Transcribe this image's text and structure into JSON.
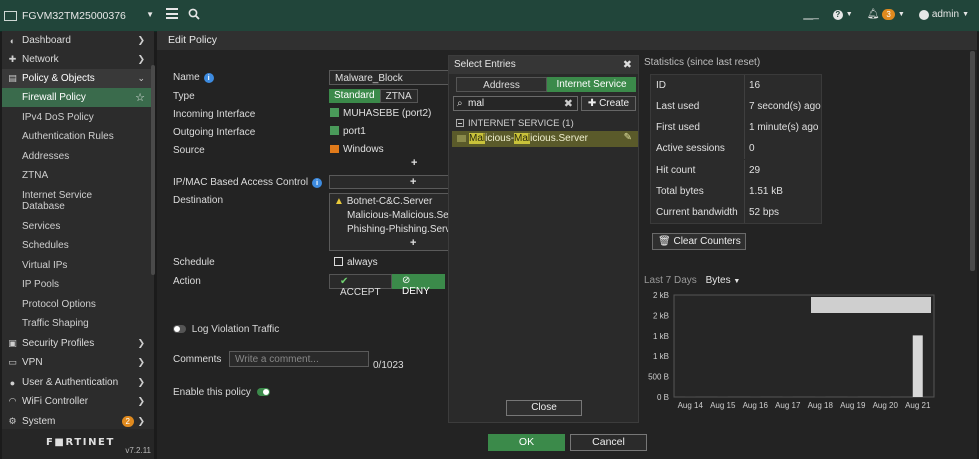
{
  "topbar": {
    "device_name": "FGVM32TM25000376",
    "terminal_label": "⎽_",
    "help_label": "?",
    "alerts_count": "3",
    "user": "admin"
  },
  "sidebar": {
    "items": [
      {
        "label": "Dashboard",
        "icon": "dashboard-icon",
        "glyph": "◐"
      },
      {
        "label": "Network",
        "icon": "network-icon",
        "glyph": "✚"
      },
      {
        "label": "Policy & Objects",
        "icon": "policy-icon",
        "glyph": "▤"
      },
      {
        "label": "Firewall Policy"
      },
      {
        "label": "IPv4 DoS Policy"
      },
      {
        "label": "Authentication Rules"
      },
      {
        "label": "Addresses"
      },
      {
        "label": "ZTNA"
      },
      {
        "label": "Internet Service Database"
      },
      {
        "label": "Services"
      },
      {
        "label": "Schedules"
      },
      {
        "label": "Virtual IPs"
      },
      {
        "label": "IP Pools"
      },
      {
        "label": "Protocol Options"
      },
      {
        "label": "Traffic Shaping"
      },
      {
        "label": "Security Profiles",
        "icon": "lock-icon",
        "glyph": "▣"
      },
      {
        "label": "VPN",
        "icon": "vpn-icon",
        "glyph": "▭"
      },
      {
        "label": "User & Authentication",
        "icon": "user-icon",
        "glyph": "●"
      },
      {
        "label": "WiFi Controller",
        "icon": "wifi-icon",
        "glyph": "◠"
      },
      {
        "label": "System",
        "icon": "gear-icon",
        "glyph": "⚙",
        "badge": "2"
      }
    ],
    "logo": "F■RTINET",
    "version": "v7.2.11"
  },
  "edit": {
    "title": "Edit Policy",
    "labels": {
      "name": "Name",
      "type": "Type",
      "incoming": "Incoming Interface",
      "outgoing": "Outgoing Interface",
      "source": "Source",
      "ipmac": "IP/MAC Based Access Control",
      "destination": "Destination",
      "schedule": "Schedule",
      "action": "Action",
      "log_violation": "Log Violation Traffic",
      "comments": "Comments",
      "enable": "Enable this policy"
    },
    "name_value": "Malware_Block",
    "type_options": [
      "Standard",
      "ZTNA"
    ],
    "incoming_value": "MUHASEBE (port2)",
    "outgoing_value": "port1",
    "source_value": "Windows",
    "destinations": [
      "Botnet-C&C.Server",
      "Malicious-Malicious.Server",
      "Phishing-Phishing.Server"
    ],
    "schedule_value": "always",
    "accept_label": "ACCEPT",
    "deny_label": "DENY",
    "comments_placeholder": "Write a comment...",
    "comments_count": "0/1023",
    "plus": "+"
  },
  "select_entries": {
    "title": "Select Entries",
    "close_glyph": "✖",
    "tabs": [
      "Address",
      "Internet Service"
    ],
    "search_value": "mal",
    "create_label": "Create",
    "group_label": "INTERNET SERVICE (1)",
    "entry_parts": [
      "",
      "Mal",
      "icious-",
      "Mal",
      "icious.Server"
    ],
    "close_label": "Close"
  },
  "stats": {
    "title": "Statistics (since last reset)",
    "rows": [
      {
        "key": "ID",
        "value": "16"
      },
      {
        "key": "Last used",
        "value": "7 second(s) ago"
      },
      {
        "key": "First used",
        "value": "1 minute(s) ago"
      },
      {
        "key": "Active sessions",
        "value": "0"
      },
      {
        "key": "Hit count",
        "value": "29"
      },
      {
        "key": "Total bytes",
        "value": "1.51 kB"
      },
      {
        "key": "Current bandwidth",
        "value": "52 bps"
      }
    ],
    "clear_label": "Clear Counters",
    "range_label": "Last 7 Days",
    "unit_select": "Bytes"
  },
  "chart_data": {
    "type": "bar",
    "categories": [
      "Aug 14",
      "Aug 15",
      "Aug 16",
      "Aug 17",
      "Aug 18",
      "Aug 19",
      "Aug 20",
      "Aug 21"
    ],
    "values": [
      0,
      0,
      0,
      0,
      0,
      0,
      0,
      1510
    ],
    "yticks": [
      "0 B",
      "500 B",
      "1 kB",
      "1 kB",
      "2 kB",
      "2 kB"
    ],
    "yvals": [
      0,
      500,
      1000,
      1500,
      2000,
      2500
    ],
    "ylim": [
      0,
      2500
    ],
    "bar_color": "#d8d8d8",
    "axis_color": "#555555"
  },
  "footer": {
    "ok_label": "OK",
    "cancel_label": "Cancel"
  }
}
